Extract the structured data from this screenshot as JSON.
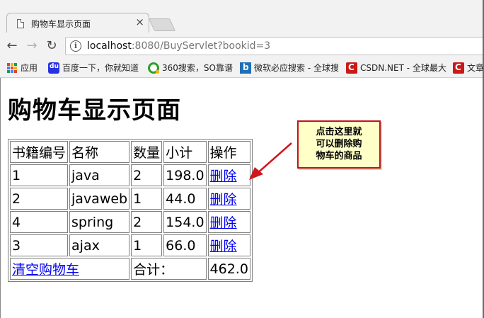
{
  "browser": {
    "tab_title": "购物车显示页面",
    "tab_close": "×",
    "url_host": "localhost",
    "url_path": ":8080/BuyServlet?bookid=3",
    "bookmarks": [
      {
        "label": "应用",
        "icon": "apps-icon"
      },
      {
        "label": "百度一下，你就知道",
        "icon": "baidu-icon"
      },
      {
        "label": "360搜索，SO靠谱",
        "icon": "360-search-icon"
      },
      {
        "label": "微软必应搜索 - 全球搜",
        "icon": "bing-icon"
      },
      {
        "label": "CSDN.NET - 全球最大",
        "icon": "csdn-icon"
      },
      {
        "label": "文章",
        "icon": "csdn-icon"
      }
    ]
  },
  "page": {
    "heading": "购物车显示页面",
    "table": {
      "headers": [
        "书籍编号",
        "名称",
        "数量",
        "小计",
        "操作"
      ],
      "rows": [
        {
          "id": "1",
          "name": "java",
          "qty": "2",
          "subtotal": "198.0",
          "action": "删除"
        },
        {
          "id": "2",
          "name": "javaweb",
          "qty": "1",
          "subtotal": "44.0",
          "action": "删除"
        },
        {
          "id": "4",
          "name": "spring",
          "qty": "2",
          "subtotal": "154.0",
          "action": "删除"
        },
        {
          "id": "3",
          "name": "ajax",
          "qty": "1",
          "subtotal": "66.0",
          "action": "删除"
        }
      ],
      "footer": {
        "clear_label": "清空购物车",
        "total_label": "合计：",
        "total_value": "462.0"
      }
    },
    "callout": {
      "line1": "点击这里就",
      "line2": "可以删除购",
      "line3": "物车的商品"
    }
  },
  "colors": {
    "link": "#0000ee",
    "callout_bg": "#ffffc8",
    "callout_border": "#c0141b",
    "arrow": "#d0141b"
  }
}
